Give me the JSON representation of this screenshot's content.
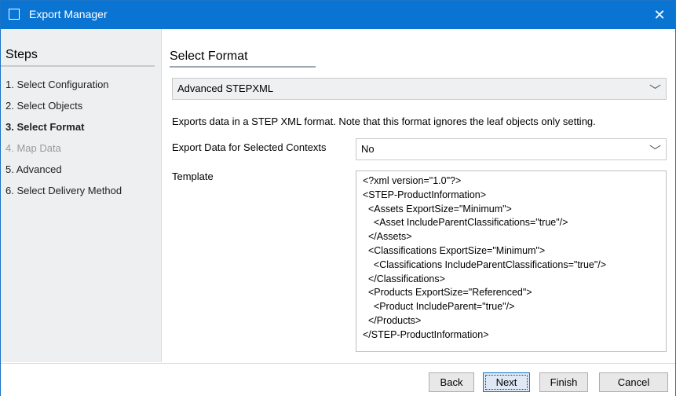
{
  "window": {
    "title": "Export Manager",
    "close_glyph": "✕"
  },
  "sidebar": {
    "header": "Steps",
    "items": [
      {
        "label": "1. Select Configuration",
        "state": "normal"
      },
      {
        "label": "2. Select Objects",
        "state": "normal"
      },
      {
        "label": "3. Select Format",
        "state": "active"
      },
      {
        "label": "4. Map Data",
        "state": "disabled"
      },
      {
        "label": "5. Advanced",
        "state": "normal"
      },
      {
        "label": "6. Select Delivery Method",
        "state": "normal"
      }
    ]
  },
  "main": {
    "section_title": "Select Format",
    "format_select": {
      "value": "Advanced STEPXML",
      "icon": "chevron-down-icon"
    },
    "description": "Exports data in a STEP XML format. Note that this format ignores the leaf objects only setting.",
    "contexts": {
      "label": "Export Data for Selected Contexts",
      "value": "No"
    },
    "template": {
      "label": "Template",
      "lines": [
        "<?xml version=\"1.0\"?>",
        "<STEP-ProductInformation>",
        "  <Assets ExportSize=\"Minimum\">",
        "    <Asset IncludeParentClassifications=\"true\"/>",
        "  </Assets>",
        "  <Classifications ExportSize=\"Minimum\">",
        "    <Classifications IncludeParentClassifications=\"true\"/>",
        "  </Classifications>",
        "  <Products ExportSize=\"Referenced\">",
        "    <Product IncludeParent=\"true\"/>",
        "  </Products>",
        "</STEP-ProductInformation>"
      ]
    }
  },
  "footer": {
    "back": "Back",
    "next": "Next",
    "finish": "Finish",
    "cancel": "Cancel"
  },
  "colors": {
    "titlebar": "#0a74d2",
    "sidebar_bg": "#edeff1",
    "accent": "#0a74d2"
  }
}
